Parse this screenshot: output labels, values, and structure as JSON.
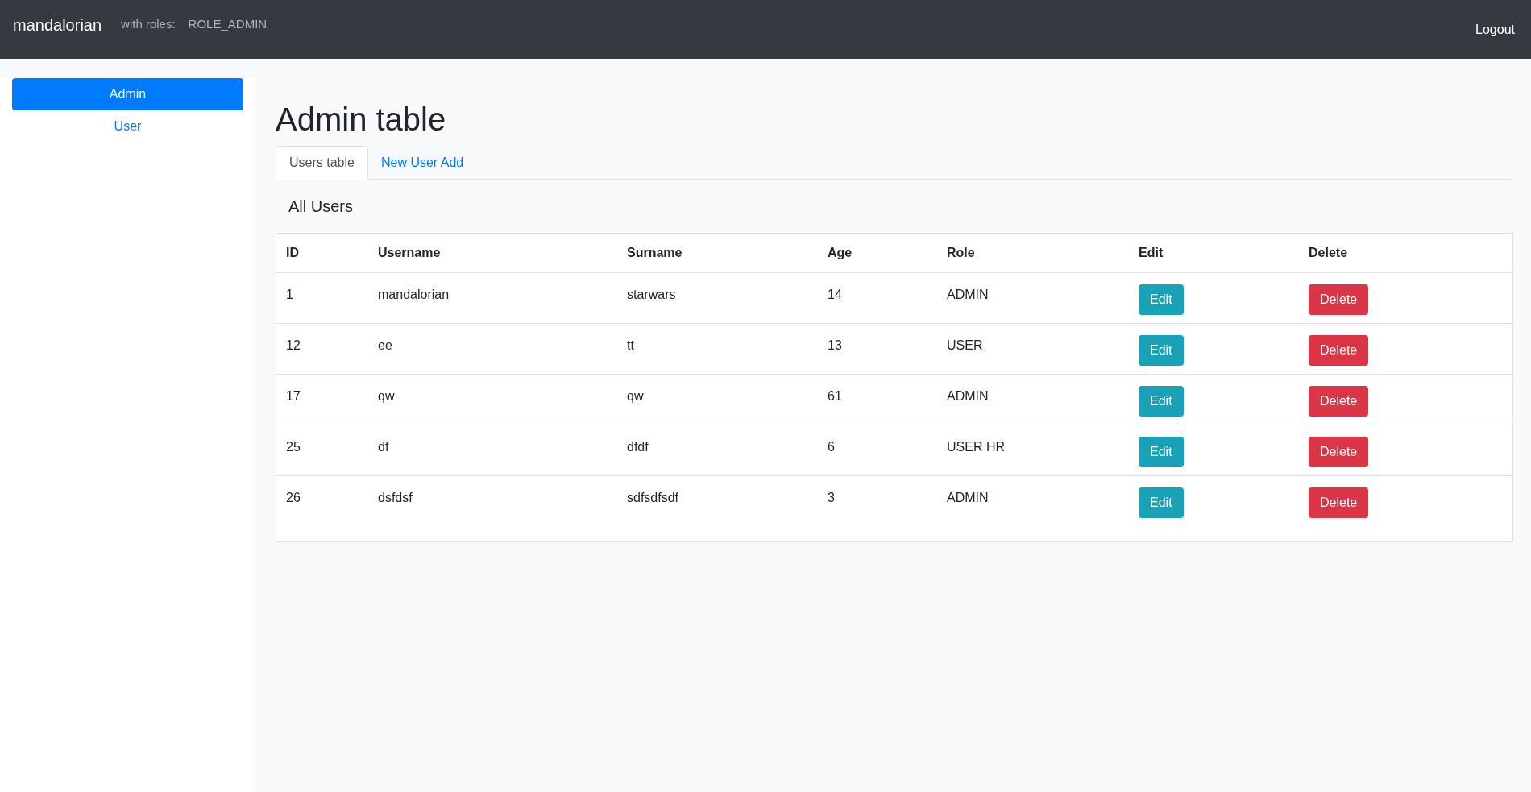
{
  "navbar": {
    "brand": "mandalorian",
    "roles_label": "with roles:",
    "roles": "ROLE_ADMIN",
    "logout": "Logout"
  },
  "sidebar": {
    "items": [
      {
        "label": "Admin",
        "selected": true
      },
      {
        "label": "User",
        "selected": false
      }
    ]
  },
  "title": "Admin table",
  "tabs": [
    {
      "label": "Users table",
      "selected": true
    },
    {
      "label": "New User Add",
      "selected": false
    }
  ],
  "section_title": "All Users",
  "table": {
    "columns": [
      "ID",
      "Username",
      "Surname",
      "Age",
      "Role",
      "Edit",
      "Delete"
    ],
    "rows": [
      {
        "cells": [
          "1",
          "mandalorian",
          "starwars",
          "14",
          "ADMIN"
        ],
        "edit": "Edit",
        "delete": "Delete"
      },
      {
        "cells": [
          "12",
          "ee",
          "tt",
          "13",
          "USER"
        ],
        "edit": "Edit",
        "delete": "Delete"
      },
      {
        "cells": [
          "17",
          "qw",
          "qw",
          "61",
          "ADMIN"
        ],
        "edit": "Edit",
        "delete": "Delete"
      },
      {
        "cells": [
          "25",
          "df",
          "dfdf",
          "6",
          "USER HR"
        ],
        "edit": "Edit",
        "delete": "Delete"
      },
      {
        "cells": [
          "26",
          "dsfdsf",
          "sdfsdfsdf",
          "3",
          "ADMIN"
        ],
        "edit": "Edit",
        "delete": "Delete"
      }
    ]
  }
}
